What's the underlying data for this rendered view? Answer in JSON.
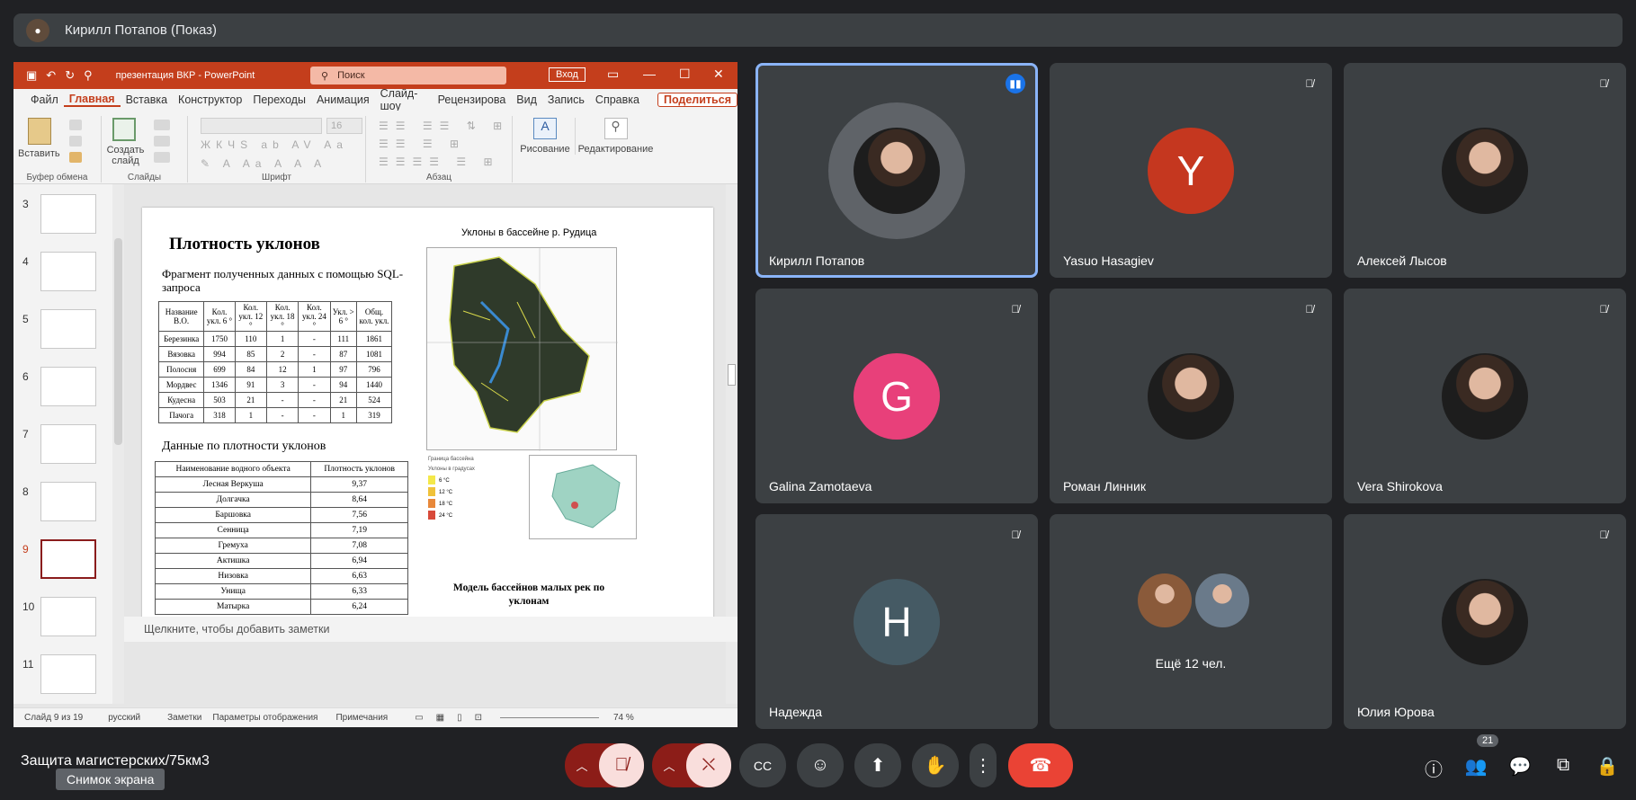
{
  "presenter": {
    "name": "Кирилл Потапов (Показ)"
  },
  "ppt": {
    "doc_title": "презентация ВКР - PowerPoint",
    "search": "Поиск",
    "login": "Вход",
    "tabs": [
      "Файл",
      "Главная",
      "Вставка",
      "Конструктор",
      "Переходы",
      "Анимация",
      "Слайд-шоу",
      "Рецензирова",
      "Вид",
      "Запись",
      "Справка"
    ],
    "share": "Поделиться",
    "groups": {
      "clipboard": "Буфер обмена",
      "slides": "Слайды",
      "font": "Шрифт",
      "paragraph": "Абзац"
    },
    "paste": "Вставить",
    "create_slide": "Создать слайд",
    "drawing": "Рисование",
    "editing": "Редактирование",
    "font_size": "16",
    "thumbnails": [
      "3",
      "4",
      "5",
      "6",
      "7",
      "8",
      "9",
      "10",
      "11"
    ],
    "notes": "Щелкните, чтобы добавить заметки",
    "status": {
      "slide": "Слайд 9 из 19",
      "lang": "русский",
      "notes": "Заметки",
      "view": "Параметры отображения",
      "comments": "Примечания",
      "zoom": "74 %"
    },
    "slide": {
      "title": "Плотность уклонов",
      "sub1": "Фрагмент полученных данных с помощью SQL-запроса",
      "table1_head": [
        "Название В.О.",
        "Кол. укл. 6 °",
        "Кол. укл. 12 °",
        "Кол. укл. 18 °",
        "Кол. укл. 24 °",
        "Укл. > 6 °",
        "Общ. кол. укл."
      ],
      "table1_rows": [
        [
          "Березинка",
          "1750",
          "110",
          "1",
          "-",
          "111",
          "1861"
        ],
        [
          "Вязовка",
          "994",
          "85",
          "2",
          "-",
          "87",
          "1081"
        ],
        [
          "Полосня",
          "699",
          "84",
          "12",
          "1",
          "97",
          "796"
        ],
        [
          "Мордвес",
          "1346",
          "91",
          "3",
          "-",
          "94",
          "1440"
        ],
        [
          "Кудесна",
          "503",
          "21",
          "-",
          "-",
          "21",
          "524"
        ],
        [
          "Пачога",
          "318",
          "1",
          "-",
          "-",
          "1",
          "319"
        ]
      ],
      "sub2": "Данные по плотности уклонов",
      "table2_head": [
        "Наименование водного объекта",
        "Плотность уклонов"
      ],
      "table2_rows": [
        [
          "Лесная Веркуша",
          "9,37"
        ],
        [
          "Долгачка",
          "8,64"
        ],
        [
          "Баршовка",
          "7,56"
        ],
        [
          "Сенница",
          "7,19"
        ],
        [
          "Гремуха",
          "7,08"
        ],
        [
          "Актишка",
          "6,94"
        ],
        [
          "Низовка",
          "6,63"
        ],
        [
          "Унища",
          "6,33"
        ],
        [
          "Матырка",
          "6,24"
        ]
      ],
      "map_title": "Уклоны в бассейне р. Рудица",
      "legend_title": "Граница бассейна",
      "legend_sub": "Уклоны в градусах",
      "legend": [
        "6 °С",
        "12 °С",
        "18 °С",
        "24 °С"
      ],
      "caption": "Модель бассейнов малых рек по уклонам",
      "page_num": "9"
    }
  },
  "tiles": [
    {
      "name": "Кирилл Потапов",
      "letter": "",
      "active": true,
      "color": "#5f6368"
    },
    {
      "name": "Yasuo Hasagiev",
      "letter": "Y",
      "active": false,
      "color": "#c5371f"
    },
    {
      "name": "Алексей Лысов",
      "letter": "",
      "active": false,
      "color": "#6b6b5a"
    },
    {
      "name": "Galina Zamotaeva",
      "letter": "G",
      "active": false,
      "color": "#e8407a"
    },
    {
      "name": "Роман Линник",
      "letter": "",
      "active": false,
      "color": "#7a6a5a"
    },
    {
      "name": "Vera Shirokova",
      "letter": "",
      "active": false,
      "color": "#8a6040"
    },
    {
      "name": "Надежда",
      "letter": "H",
      "active": false,
      "color": "#455a64"
    },
    {
      "name": "",
      "letter": "",
      "active": false,
      "color": "#3c4043",
      "more": "Ещё 12 чел."
    },
    {
      "name": "Юлия Юрова",
      "letter": "",
      "active": false,
      "color": "#5a7a8a"
    }
  ],
  "meeting": {
    "title": "Защита магистерских/75км3",
    "tooltip": "Снимок экрана",
    "participants": "21"
  }
}
